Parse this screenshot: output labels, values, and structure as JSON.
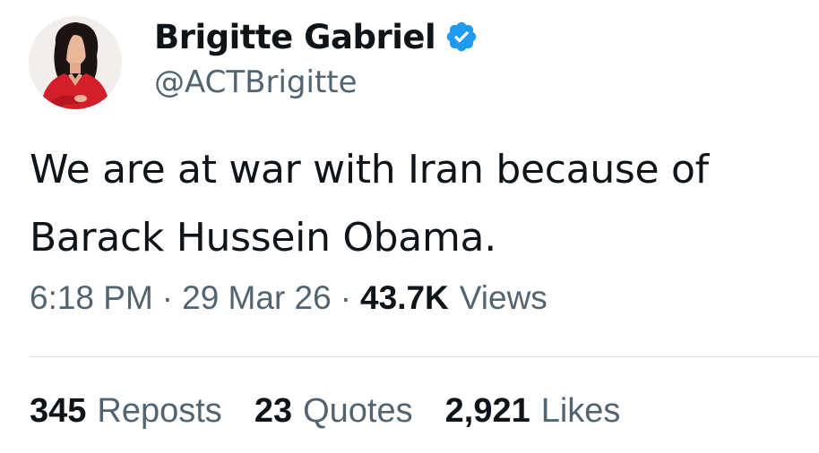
{
  "author": {
    "display_name": "Brigitte Gabriel",
    "handle": "@ACTBrigitte",
    "verified": true,
    "verified_color": "#1d9bf0"
  },
  "tweet": {
    "text": "We are at war with Iran because of Barack Hussein Obama."
  },
  "meta": {
    "time": "6:18 PM",
    "separator": "·",
    "date": "29 Mar 26",
    "views_count": "43.7K",
    "views_label": "Views"
  },
  "stats": {
    "reposts": {
      "count": "345",
      "label": "Reposts"
    },
    "quotes": {
      "count": "23",
      "label": "Quotes"
    },
    "likes": {
      "count": "2,921",
      "label": "Likes"
    }
  },
  "colors": {
    "text_primary": "#0f1419",
    "text_secondary": "#536471",
    "divider": "#cfd9de"
  }
}
